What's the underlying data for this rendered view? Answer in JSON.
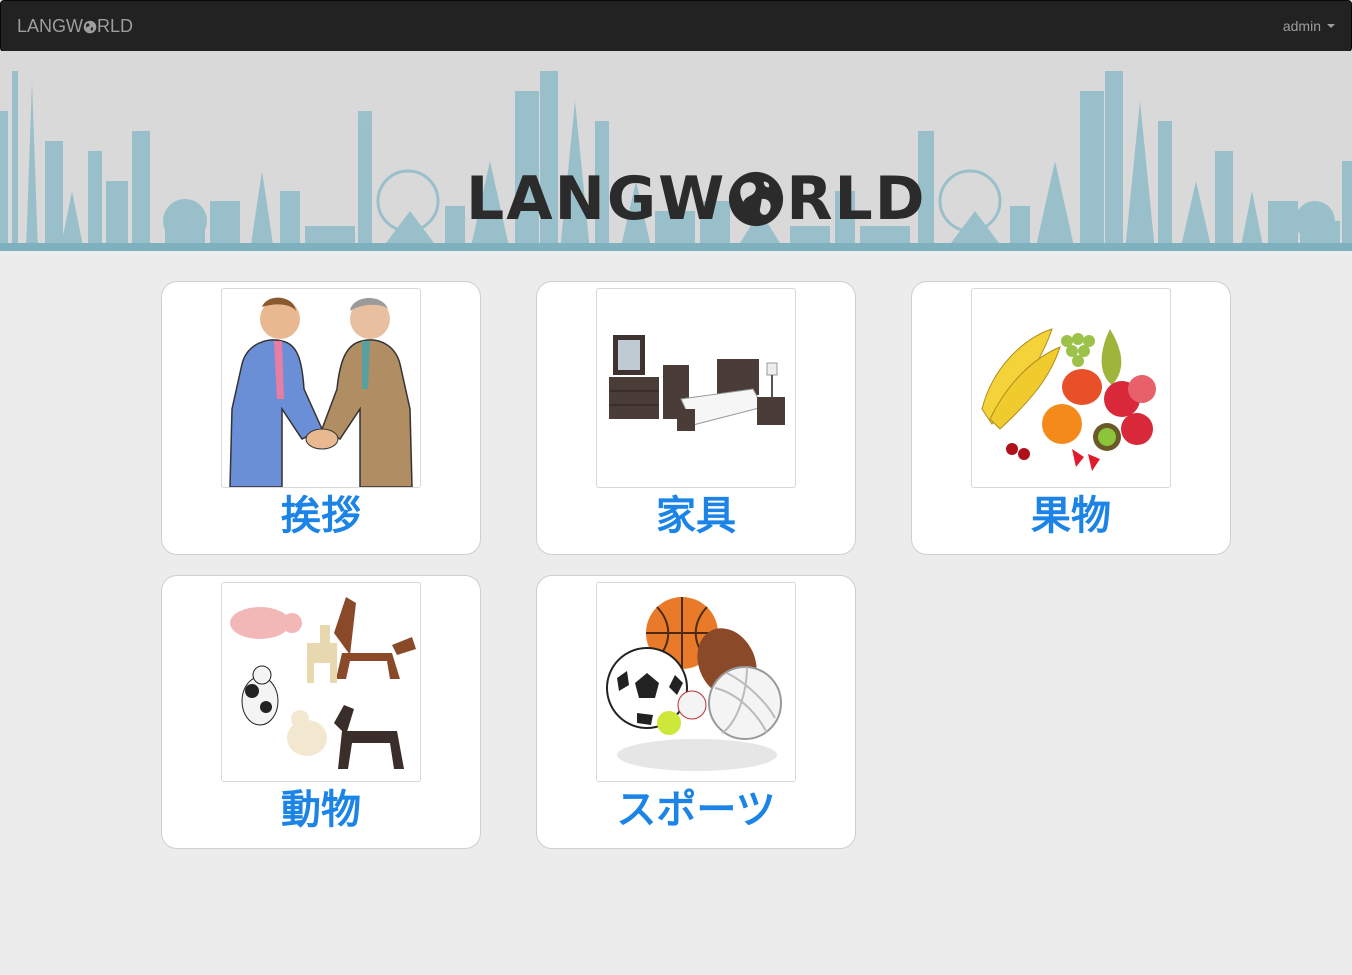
{
  "navbar": {
    "brand_prefix": "LANGW",
    "brand_suffix": "RLD",
    "user": "admin"
  },
  "banner": {
    "logo_prefix": "LANGW",
    "logo_suffix": "RLD"
  },
  "categories": [
    {
      "label": "挨拶",
      "icon": "handshake-image"
    },
    {
      "label": "家具",
      "icon": "bedroom-furniture-image"
    },
    {
      "label": "果物",
      "icon": "fruit-basket-image"
    },
    {
      "label": "動物",
      "icon": "animal-figures-image"
    },
    {
      "label": "スポーツ",
      "icon": "sports-balls-image"
    }
  ],
  "colors": {
    "navbar_bg": "#222222",
    "label_blue": "#1b84e6",
    "page_bg": "#ececec",
    "skyline": "#7fb0bd"
  }
}
